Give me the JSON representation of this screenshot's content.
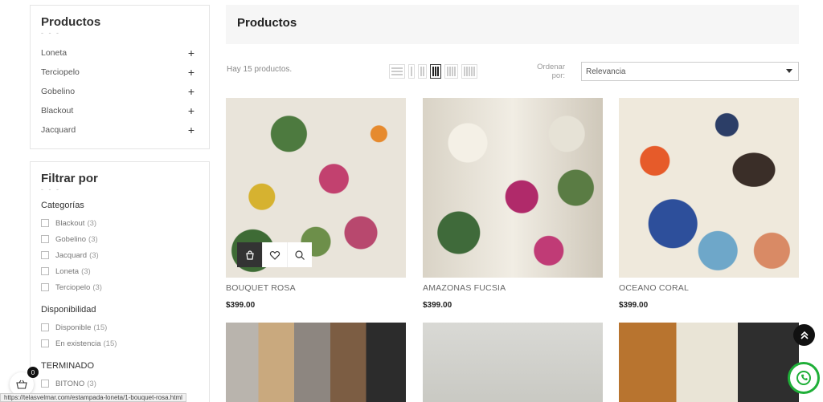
{
  "sidebar": {
    "categories_title": "Productos",
    "title_dashes": "- - -",
    "categories": [
      {
        "label": "Loneta",
        "toggle": "+"
      },
      {
        "label": "Terciopelo",
        "toggle": "+"
      },
      {
        "label": "Gobelino",
        "toggle": "+"
      },
      {
        "label": "Blackout",
        "toggle": "+"
      },
      {
        "label": "Jacquard",
        "toggle": "+"
      }
    ],
    "filter_title": "Filtrar por",
    "filter_sections": {
      "categorias": {
        "title": "Categorías",
        "options": [
          {
            "label": "Blackout",
            "count": "(3)"
          },
          {
            "label": "Gobelino",
            "count": "(3)"
          },
          {
            "label": "Jacquard",
            "count": "(3)"
          },
          {
            "label": "Loneta",
            "count": "(3)"
          },
          {
            "label": "Terciopelo",
            "count": "(3)"
          }
        ]
      },
      "disponibilidad": {
        "title": "Disponibilidad",
        "options": [
          {
            "label": "Disponible",
            "count": "(15)"
          },
          {
            "label": "En existencia",
            "count": "(15)"
          }
        ]
      },
      "terminado": {
        "title": "TERMINADO",
        "options": [
          {
            "label": "BITONO",
            "count": "(3)"
          }
        ]
      }
    }
  },
  "main": {
    "title": "Productos",
    "product_count": "Hay 15 productos.",
    "sort_label": "Ordenar por:",
    "sort_value": "Relevancia",
    "grid_views": [
      "list",
      "grid-2",
      "grid-3",
      "grid-4",
      "grid-5",
      "grid-6"
    ],
    "active_view": "grid-4"
  },
  "products": [
    {
      "name": "BOUQUET ROSA",
      "price": "$399.00",
      "image": "floral-multicolor"
    },
    {
      "name": "AMAZONAS FUCSIA",
      "price": "$399.00",
      "image": "floral-fuchsia"
    },
    {
      "name": "OCEANO CORAL",
      "price": "$399.00",
      "image": "ocean-coral"
    },
    {
      "name": "",
      "price": "",
      "image": "velvet-multicolor"
    },
    {
      "name": "",
      "price": "",
      "image": "gray-fabric"
    },
    {
      "name": "",
      "price": "",
      "image": "multicolor-fabric"
    }
  ],
  "card_actions": [
    "bag-icon",
    "heart-icon",
    "magnifier-icon"
  ],
  "floating": {
    "cart_count": "0",
    "status_url": "https://telasvelmar.com/estampada-loneta/1-bouquet-rosa.html"
  },
  "colors": {
    "accent": "#333333",
    "whatsapp": "#1faf38",
    "top_bar": "#f6f6f6"
  }
}
